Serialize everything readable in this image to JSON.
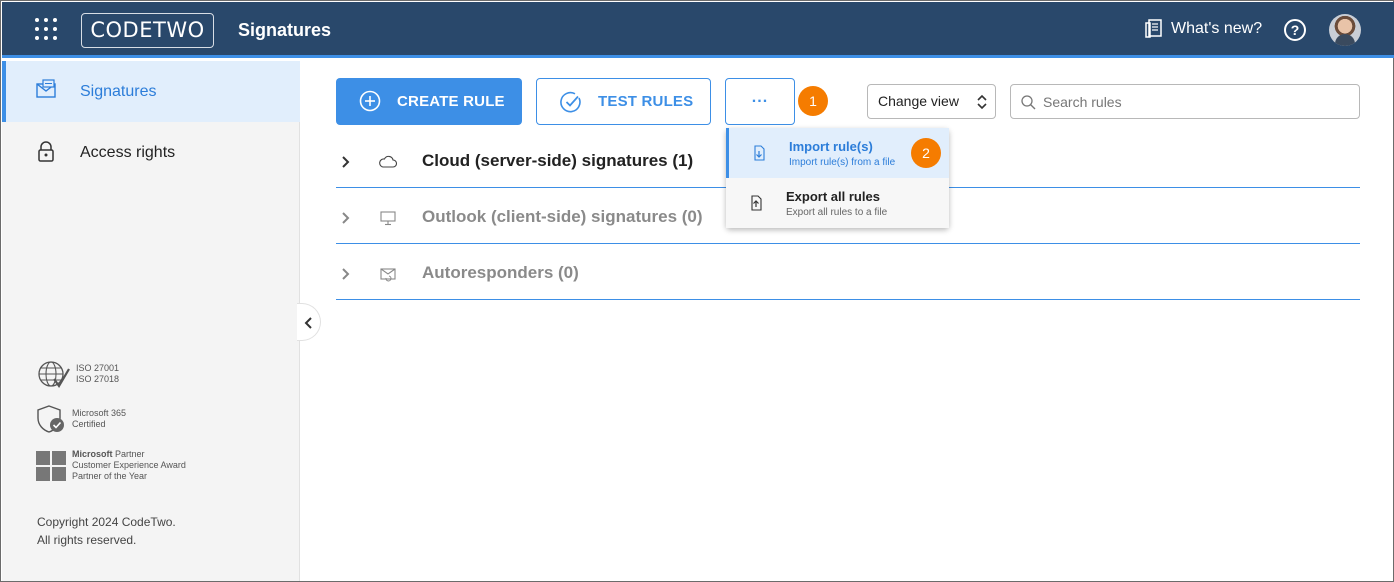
{
  "header": {
    "logo_text_a": "CODE",
    "logo_text_b": "TWO",
    "app_title": "Signatures",
    "whats_new": "What's new?",
    "help_symbol": "?"
  },
  "sidebar": {
    "items": [
      {
        "label": "Signatures",
        "icon": "signature-mail-icon",
        "active": true
      },
      {
        "label": "Access rights",
        "icon": "lock-icon",
        "active": false
      }
    ],
    "certs": [
      {
        "line1": "ISO 27001",
        "line2": "ISO 27018"
      },
      {
        "line1": "Microsoft 365",
        "line2": "Certified"
      },
      {
        "line1_bold": "Microsoft",
        "line1_rest": " Partner",
        "line2": "Customer Experience Award",
        "line3": "Partner of the Year"
      }
    ],
    "copyright_line1": "Copyright 2024 CodeTwo.",
    "copyright_line2": "All rights reserved."
  },
  "toolbar": {
    "create_rule": "CREATE RULE",
    "test_rules": "TEST RULES",
    "more": "···",
    "callout_1": "1",
    "change_view": "Change view",
    "search_placeholder": "Search rules"
  },
  "groups": [
    {
      "label": "Cloud (server-side) signatures (1)",
      "icon": "cloud-icon",
      "enabled": true
    },
    {
      "label": "Outlook (client-side) signatures (0)",
      "icon": "monitor-icon",
      "enabled": false
    },
    {
      "label": "Autoresponders (0)",
      "icon": "autoresponder-icon",
      "enabled": false
    }
  ],
  "dropdown": {
    "items": [
      {
        "title": "Import rule(s)",
        "subtitle": "Import rule(s) from a file"
      },
      {
        "title": "Export all rules",
        "subtitle": "Export all rules to a file"
      }
    ],
    "callout_2": "2"
  },
  "colors": {
    "header_bg": "#29486b",
    "accent": "#3d8fe6",
    "callout": "#f57c00"
  }
}
